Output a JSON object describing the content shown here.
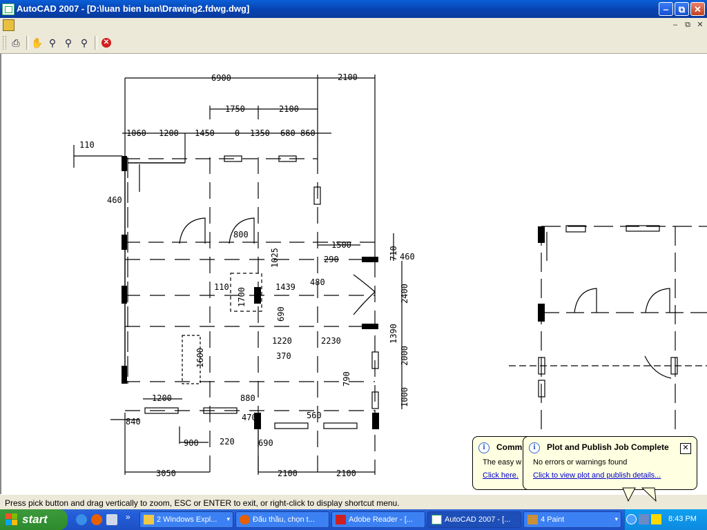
{
  "window": {
    "title": "AutoCAD 2007 - [D:\\luan bien ban\\Drawing2.fdwg.dwg]",
    "minimize_glyph": "‒",
    "maximize_glyph": "⧉",
    "close_glyph": "✕"
  },
  "mdi": {
    "minimize_glyph": "–",
    "restore_glyph": "⧉",
    "close_glyph": "✕"
  },
  "toolbar": {
    "icons": [
      "plot-icon",
      "pan-icon",
      "zoom-realtime-icon",
      "zoom-window-icon",
      "zoom-previous-icon",
      "close-preview-icon"
    ],
    "close_preview_glyph": "✕"
  },
  "drawing": {
    "dims_top": [
      "6900",
      "2100",
      "1750",
      "2100"
    ],
    "dims_row": [
      "1060",
      "1200",
      "1450",
      "0",
      "1350",
      "680",
      "860"
    ],
    "dims_left": [
      "110",
      "460",
      "840"
    ],
    "dims_middle": [
      "800",
      "1500",
      "290",
      "1025",
      "480",
      "110",
      "1439",
      "1700",
      "690",
      "1220",
      "2230",
      "370",
      "1600"
    ],
    "dims_right": [
      "460",
      "710",
      "2400",
      "1390",
      "2000",
      "790",
      "1000"
    ],
    "dims_bottom": [
      "1200",
      "880",
      "470",
      "560",
      "900",
      "220",
      "690",
      "3050",
      "2100",
      "2100"
    ]
  },
  "status": {
    "prompt": "Press pick button and drag vertically to zoom, ESC or ENTER to exit, or right-click to display shortcut menu."
  },
  "taskbar": {
    "start_label": "start",
    "more_glyph": "»",
    "dropdown_glyph": "▾",
    "tasks": [
      {
        "label": "2 Windows Expl...",
        "icon": "folder-icon"
      },
      {
        "label": "Đấu thầu, chọn t...",
        "icon": "firefox-icon"
      },
      {
        "label": "Adobe Reader - [...",
        "icon": "adobe-reader-icon"
      },
      {
        "label": "AutoCAD 2007 - [...",
        "icon": "autocad-icon"
      },
      {
        "label": "4 Paint",
        "icon": "paint-icon"
      }
    ],
    "clock": "8:43 PM"
  },
  "balloons": {
    "back": {
      "title": "Commu",
      "body": "The easy w",
      "link": "Click here."
    },
    "front": {
      "title": "Plot and Publish Job Complete",
      "body": "No errors or warnings found",
      "link": "Click to view plot and publish details...",
      "close_glyph": "✕"
    },
    "info_glyph": "i"
  },
  "colors": {
    "titlebar": "#0842b0",
    "chrome": "#ece9d8",
    "taskbar": "#245edb",
    "start": "#2d8a2d",
    "balloon": "#ffffe1",
    "hatch": "#000000"
  }
}
